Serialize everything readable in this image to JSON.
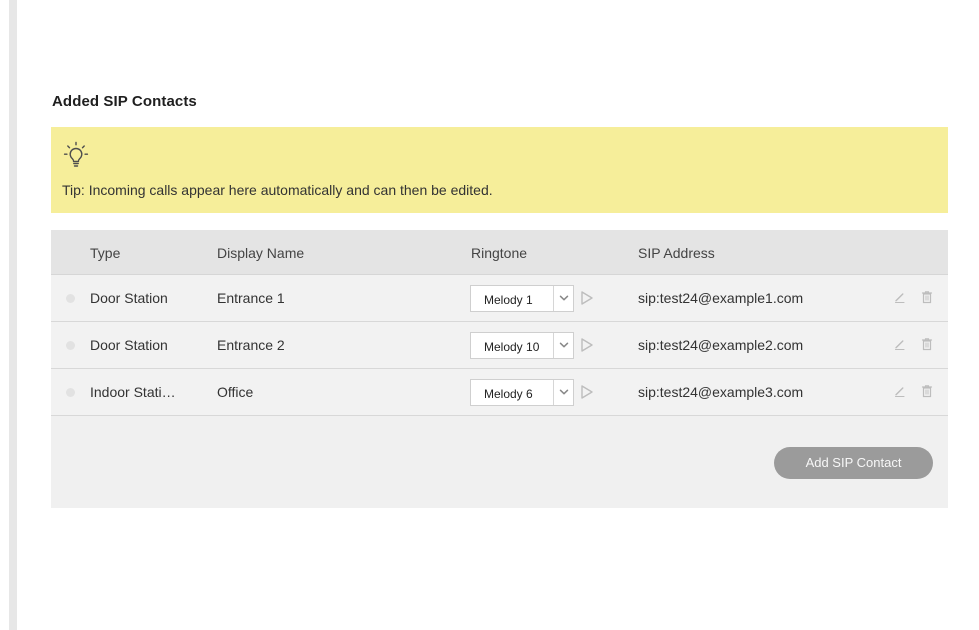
{
  "section": {
    "title": "Added SIP Contacts"
  },
  "tip": {
    "icon": "lightbulb-icon",
    "text": "Tip: Incoming calls appear here automatically and can then be edited."
  },
  "table": {
    "headers": {
      "type": "Type",
      "display_name": "Display Name",
      "ringtone": "Ringtone",
      "sip_address": "SIP Address"
    },
    "rows": [
      {
        "type": "Door Station",
        "display_name": "Entrance 1",
        "ringtone": "Melody 1",
        "sip_address": "sip:test24@example1.com"
      },
      {
        "type": "Door Station",
        "display_name": "Entrance 2",
        "ringtone": "Melody 10",
        "sip_address": "sip:test24@example2.com"
      },
      {
        "type": "Indoor Stati…",
        "display_name": "Office",
        "ringtone": "Melody 6",
        "sip_address": "sip:test24@example3.com"
      }
    ]
  },
  "actions": {
    "add_label": "Add SIP Contact"
  },
  "colors": {
    "tip_background": "#f6ee9a",
    "table_background": "#f0f0f0",
    "header_background": "#e4e4e4",
    "button_background": "#9b9b9b",
    "icon_gray": "#bfbfbf"
  }
}
